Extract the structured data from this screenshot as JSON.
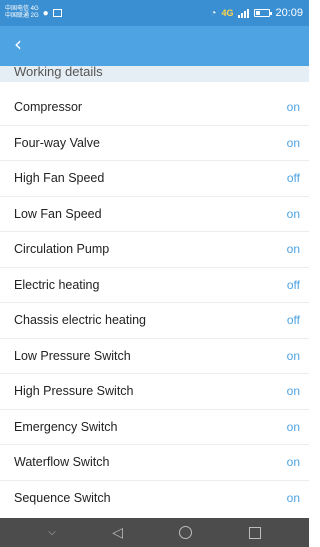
{
  "status_bar": {
    "carrier_line1": "中国电信 4G",
    "carrier_line2": "中国联通 2G",
    "network_label": "4G",
    "time": "20:09",
    "icons": [
      "chat-icon",
      "image-icon",
      "alarm-icon",
      "signal-icon",
      "battery-icon"
    ]
  },
  "header": {
    "back_icon": "chevron-left-icon"
  },
  "section": {
    "title": "Working details"
  },
  "rows": [
    {
      "label": "Compressor",
      "value": "on"
    },
    {
      "label": "Four-way Valve",
      "value": "on"
    },
    {
      "label": "High Fan Speed",
      "value": "off"
    },
    {
      "label": "Low Fan Speed",
      "value": "on"
    },
    {
      "label": "Circulation Pump",
      "value": "on"
    },
    {
      "label": "Electric heating",
      "value": "off"
    },
    {
      "label": "Chassis electric heating",
      "value": "off"
    },
    {
      "label": "Low Pressure Switch",
      "value": "on"
    },
    {
      "label": "High Pressure Switch",
      "value": "on"
    },
    {
      "label": "Emergency Switch",
      "value": "on"
    },
    {
      "label": "Waterflow Switch",
      "value": "on"
    },
    {
      "label": "Sequence Switch",
      "value": "on"
    }
  ],
  "nav_bar": {
    "icons": [
      "collapse-icon",
      "back-triangle-icon",
      "home-circle-icon",
      "recents-square-icon"
    ]
  },
  "colors": {
    "header": "#4ea3e3",
    "status_bar": "#3a8fd2",
    "value_text": "#4ea3e3",
    "nav_bar": "#4c4c4c"
  }
}
